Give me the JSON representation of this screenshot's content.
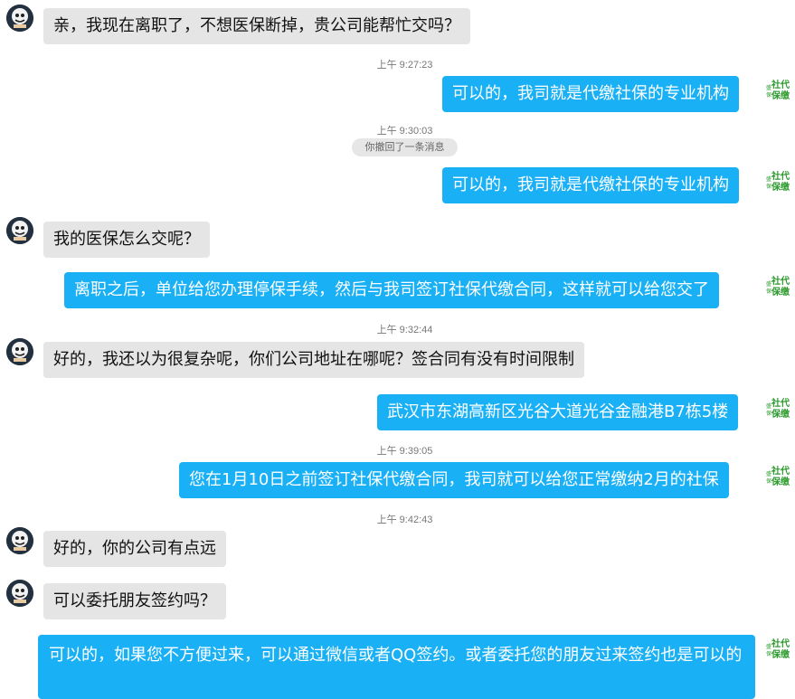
{
  "brand": {
    "accent": "#1ab0f5",
    "incoming_bubble": "#e5e5e5",
    "logo_text_line1": "社代",
    "logo_text_line2": "保缴",
    "logo_color": "#2c9a2c"
  },
  "messages": [
    {
      "kind": "in",
      "text": "亲，我现在离职了，不想医保断掉，贵公司能帮忙交吗？"
    },
    {
      "kind": "time",
      "text": "上午 9:27:23"
    },
    {
      "kind": "out",
      "text": "可以的，我司就是代缴社保的专业机构"
    },
    {
      "kind": "time",
      "text": "上午 9:30:03"
    },
    {
      "kind": "recall",
      "text": "你撤回了一条消息"
    },
    {
      "kind": "out",
      "text": "可以的，我司就是代缴社保的专业机构"
    },
    {
      "kind": "in",
      "text": "我的医保怎么交呢？"
    },
    {
      "kind": "out",
      "text": "离职之后，单位给您办理停保手续，然后与我司签订社保代缴合同，这样就可以给您交了"
    },
    {
      "kind": "time",
      "text": "上午 9:32:44"
    },
    {
      "kind": "in",
      "text": "好的，我还以为很复杂呢，你们公司地址在哪呢？签合同有没有时间限制"
    },
    {
      "kind": "out",
      "text": "武汉市东湖高新区光谷大道光谷金融港B7栋5楼"
    },
    {
      "kind": "time",
      "text": "上午 9:39:05"
    },
    {
      "kind": "out",
      "text": "您在1月10日之前签订社保代缴合同，我司就可以给您正常缴纳2月的社保"
    },
    {
      "kind": "time",
      "text": "上午 9:42:43"
    },
    {
      "kind": "in",
      "text": "好的，你的公司有点远"
    },
    {
      "kind": "in",
      "text": "可以委托朋友签约吗？"
    },
    {
      "kind": "out",
      "text": "可以的，如果您不方便过来，可以通过微信或者QQ签约。或者委托您的朋友过来签约也是可以的"
    }
  ]
}
